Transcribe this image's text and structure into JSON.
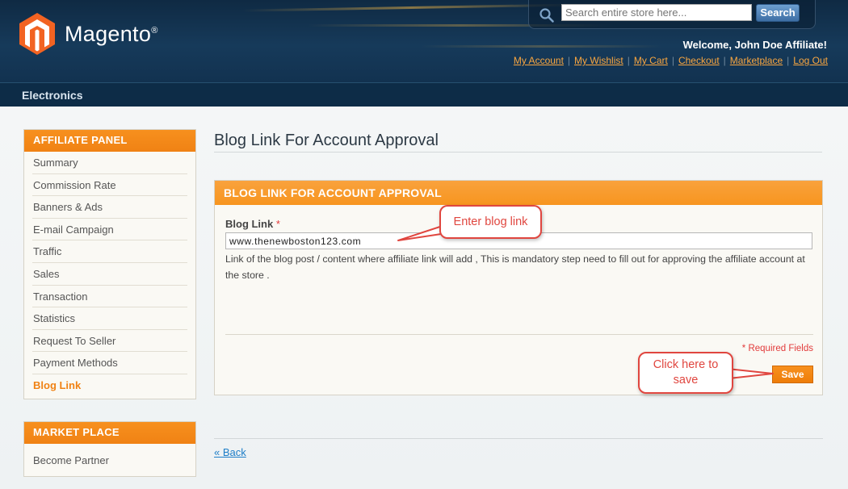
{
  "header": {
    "logo_text": "Magento",
    "logo_mark": "®",
    "search": {
      "placeholder": "Search entire store here...",
      "button_label": "Search"
    },
    "welcome": "Welcome, John Doe Affiliate!",
    "links": [
      {
        "label": "My Account"
      },
      {
        "label": "My Wishlist"
      },
      {
        "label": "My Cart"
      },
      {
        "label": "Checkout"
      },
      {
        "label": "Marketplace"
      },
      {
        "label": "Log Out"
      }
    ]
  },
  "nav": {
    "items": [
      {
        "label": "Electronics"
      }
    ]
  },
  "sidebar": {
    "affiliate_panel": {
      "title": "AFFILIATE PANEL",
      "items": [
        {
          "label": "Summary"
        },
        {
          "label": "Commission Rate"
        },
        {
          "label": "Banners & Ads"
        },
        {
          "label": "E-mail Campaign"
        },
        {
          "label": "Traffic"
        },
        {
          "label": "Sales"
        },
        {
          "label": "Transaction"
        },
        {
          "label": "Statistics"
        },
        {
          "label": "Request To Seller"
        },
        {
          "label": "Payment Methods"
        },
        {
          "label": "Blog Link"
        }
      ],
      "active_item": "Blog Link"
    },
    "market_place": {
      "title": "MARKET PLACE",
      "items": [
        {
          "label": "Become Partner"
        }
      ]
    }
  },
  "main": {
    "page_title": "Blog Link For Account Approval",
    "panel": {
      "heading": "BLOG LINK FOR ACCOUNT APPROVAL",
      "field_label": "Blog Link",
      "required_mark": "*",
      "field_value": "www.thenewboston123.com",
      "help_text": "Link of the blog post / content where affiliate link will add , This is mandatory step need to fill out for approving the affiliate account at the store .",
      "required_note": "* Required Fields",
      "save_label": "Save"
    },
    "back_label": "« Back"
  },
  "annotations": {
    "blog_link_callout": "Enter blog link",
    "save_callout": "Click here to save"
  },
  "colors": {
    "accent_orange": "#f7901e",
    "header_navy": "#163a5a",
    "link_orange": "#f9a640",
    "callout_red": "#e0463f",
    "link_blue": "#1e7ec8"
  },
  "icons": {
    "search": "search-icon",
    "logo": "magento-logo-icon"
  }
}
